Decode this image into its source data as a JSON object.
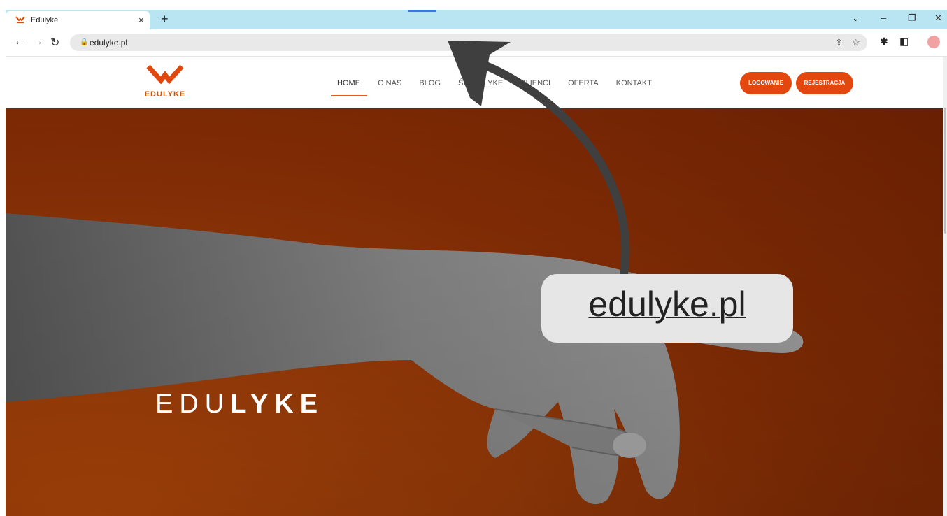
{
  "browser": {
    "tab_title": "Edulyke",
    "tab_close": "×",
    "new_tab": "+",
    "url": "edulyke.pl",
    "window_controls": [
      "⌄",
      "–",
      "❐",
      "✕"
    ]
  },
  "site": {
    "logo_text": "EDULYKE",
    "menu": [
      "HOME",
      "O NAS",
      "BLOG",
      "ŚWIAT LYKE",
      "KLIENCI",
      "OFERTA",
      "KONTAKT"
    ],
    "active_menu": "HOME",
    "login_label": "LOGOWANIE",
    "register_label": "REJESTRACJA",
    "brand_color": "#e2480e"
  },
  "hero": {
    "title_light": "EDU",
    "title_bold": "LYKE"
  },
  "overlay": {
    "callout_text": "edulyke.pl",
    "arrow_color": "#3f3f3f"
  },
  "icons": [
    "back-arrow-icon",
    "forward-arrow-icon",
    "reload-icon",
    "lock-icon",
    "share-icon",
    "star-icon",
    "extensions-icon",
    "side-panel-icon",
    "profile-avatar-icon",
    "more-menu-icon"
  ]
}
